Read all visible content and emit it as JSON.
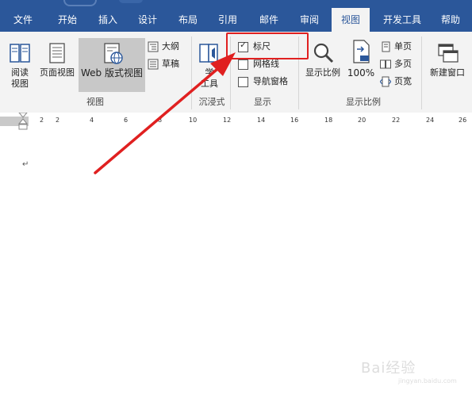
{
  "tabs": [
    {
      "label": "文件",
      "active": false
    },
    {
      "label": "开始",
      "active": false
    },
    {
      "label": "插入",
      "active": false
    },
    {
      "label": "设计",
      "active": false
    },
    {
      "label": "布局",
      "active": false
    },
    {
      "label": "引用",
      "active": false
    },
    {
      "label": "邮件",
      "active": false
    },
    {
      "label": "审阅",
      "active": false
    },
    {
      "label": "视图",
      "active": true
    },
    {
      "label": "开发工具",
      "active": false
    },
    {
      "label": "帮助",
      "active": false
    }
  ],
  "views_group": {
    "read_mode_1": "阅读",
    "read_mode_2": "视图",
    "print_layout": "页面视图",
    "web_layout": "Web 版式视图",
    "outline": "大纲",
    "draft": "草稿",
    "label": "视图"
  },
  "immersive_group": {
    "learning_tools_1": "学",
    "learning_tools_2": "工具",
    "label": "沉浸式"
  },
  "show_group": {
    "ruler": "标尺",
    "ruler_checked": true,
    "gridlines": "网格线",
    "gridlines_checked": false,
    "nav_pane": "导航窗格",
    "nav_pane_checked": false,
    "label": "显示"
  },
  "zoom_group": {
    "zoom": "显示比例",
    "hundred": "100%",
    "one_page": "单页",
    "multi_page": "多页",
    "page_width": "页宽",
    "label": "显示比例"
  },
  "window_group": {
    "new_window": "新建窗口"
  },
  "ruler": {
    "ticks": [
      "2",
      "2",
      "4",
      "6",
      "8",
      "10",
      "12",
      "14",
      "16",
      "18",
      "20",
      "22",
      "24",
      "26"
    ]
  },
  "document": {
    "paragraph_mark": "↵"
  },
  "watermark": {
    "brand": "Bai经验",
    "url": "jingyan.baidu.com"
  },
  "colors": {
    "tabbar": "#2b579a",
    "ribbon": "#f3f3f3",
    "highlight": "#e02020"
  }
}
